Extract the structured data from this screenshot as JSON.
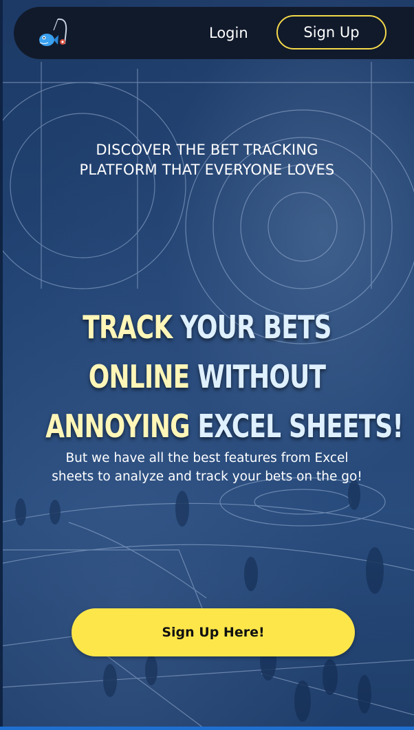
{
  "nav": {
    "logo_icon": "fish-with-fishing-rod-logo",
    "login_label": "Login",
    "signup_label": "Sign Up"
  },
  "hero": {
    "eyebrow_line1": "DISCOVER THE BET TRACKING",
    "eyebrow_line2": "PLATFORM THAT EVERYONE LOVES",
    "headline": {
      "line1_a": "TRACK",
      "line1_b": "YOUR BETS",
      "line2_a": "ONLINE",
      "line2_b": "WITHOUT",
      "line3_a": "ANNOYING",
      "line3_b": "EXCEL SHEETS!"
    },
    "subtitle_line1": "But we have all the best features from Excel",
    "subtitle_line2": "sheets to analyze and track your bets on the go!",
    "cta_label": "Sign Up Here!"
  },
  "colors": {
    "accent": "#fde64a",
    "navbar_bg": "#111a2b",
    "background": "#214373",
    "headline_yellow": "#fff6b8",
    "headline_blue": "#dff0ff"
  }
}
